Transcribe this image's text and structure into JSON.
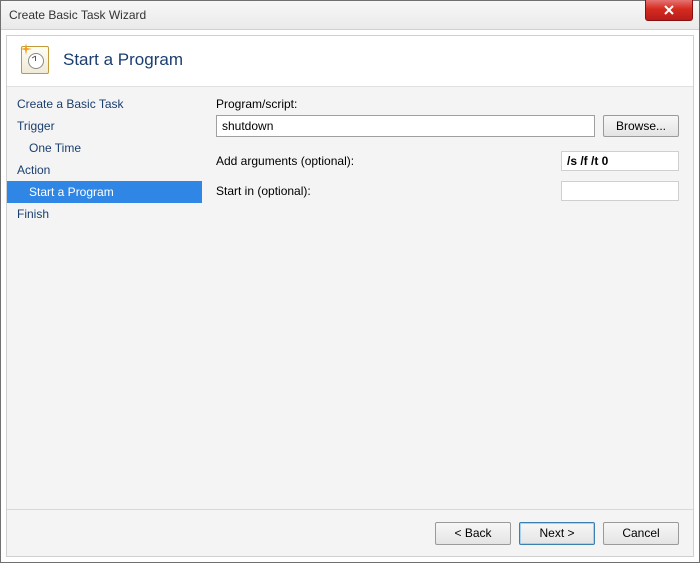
{
  "window": {
    "title": "Create Basic Task Wizard"
  },
  "header": {
    "title": "Start a Program"
  },
  "sidebar": {
    "items": [
      {
        "label": "Create a Basic Task",
        "indent": false,
        "selected": false
      },
      {
        "label": "Trigger",
        "indent": false,
        "selected": false
      },
      {
        "label": "One Time",
        "indent": true,
        "selected": false
      },
      {
        "label": "Action",
        "indent": false,
        "selected": false
      },
      {
        "label": "Start a Program",
        "indent": true,
        "selected": true
      },
      {
        "label": "Finish",
        "indent": false,
        "selected": false
      }
    ]
  },
  "form": {
    "program_label": "Program/script:",
    "program_value": "shutdown",
    "browse_label": "Browse...",
    "arguments_label": "Add arguments (optional):",
    "arguments_value": "/s /f /t 0",
    "startin_label": "Start in (optional):",
    "startin_value": ""
  },
  "footer": {
    "back": "< Back",
    "next": "Next >",
    "cancel": "Cancel"
  }
}
